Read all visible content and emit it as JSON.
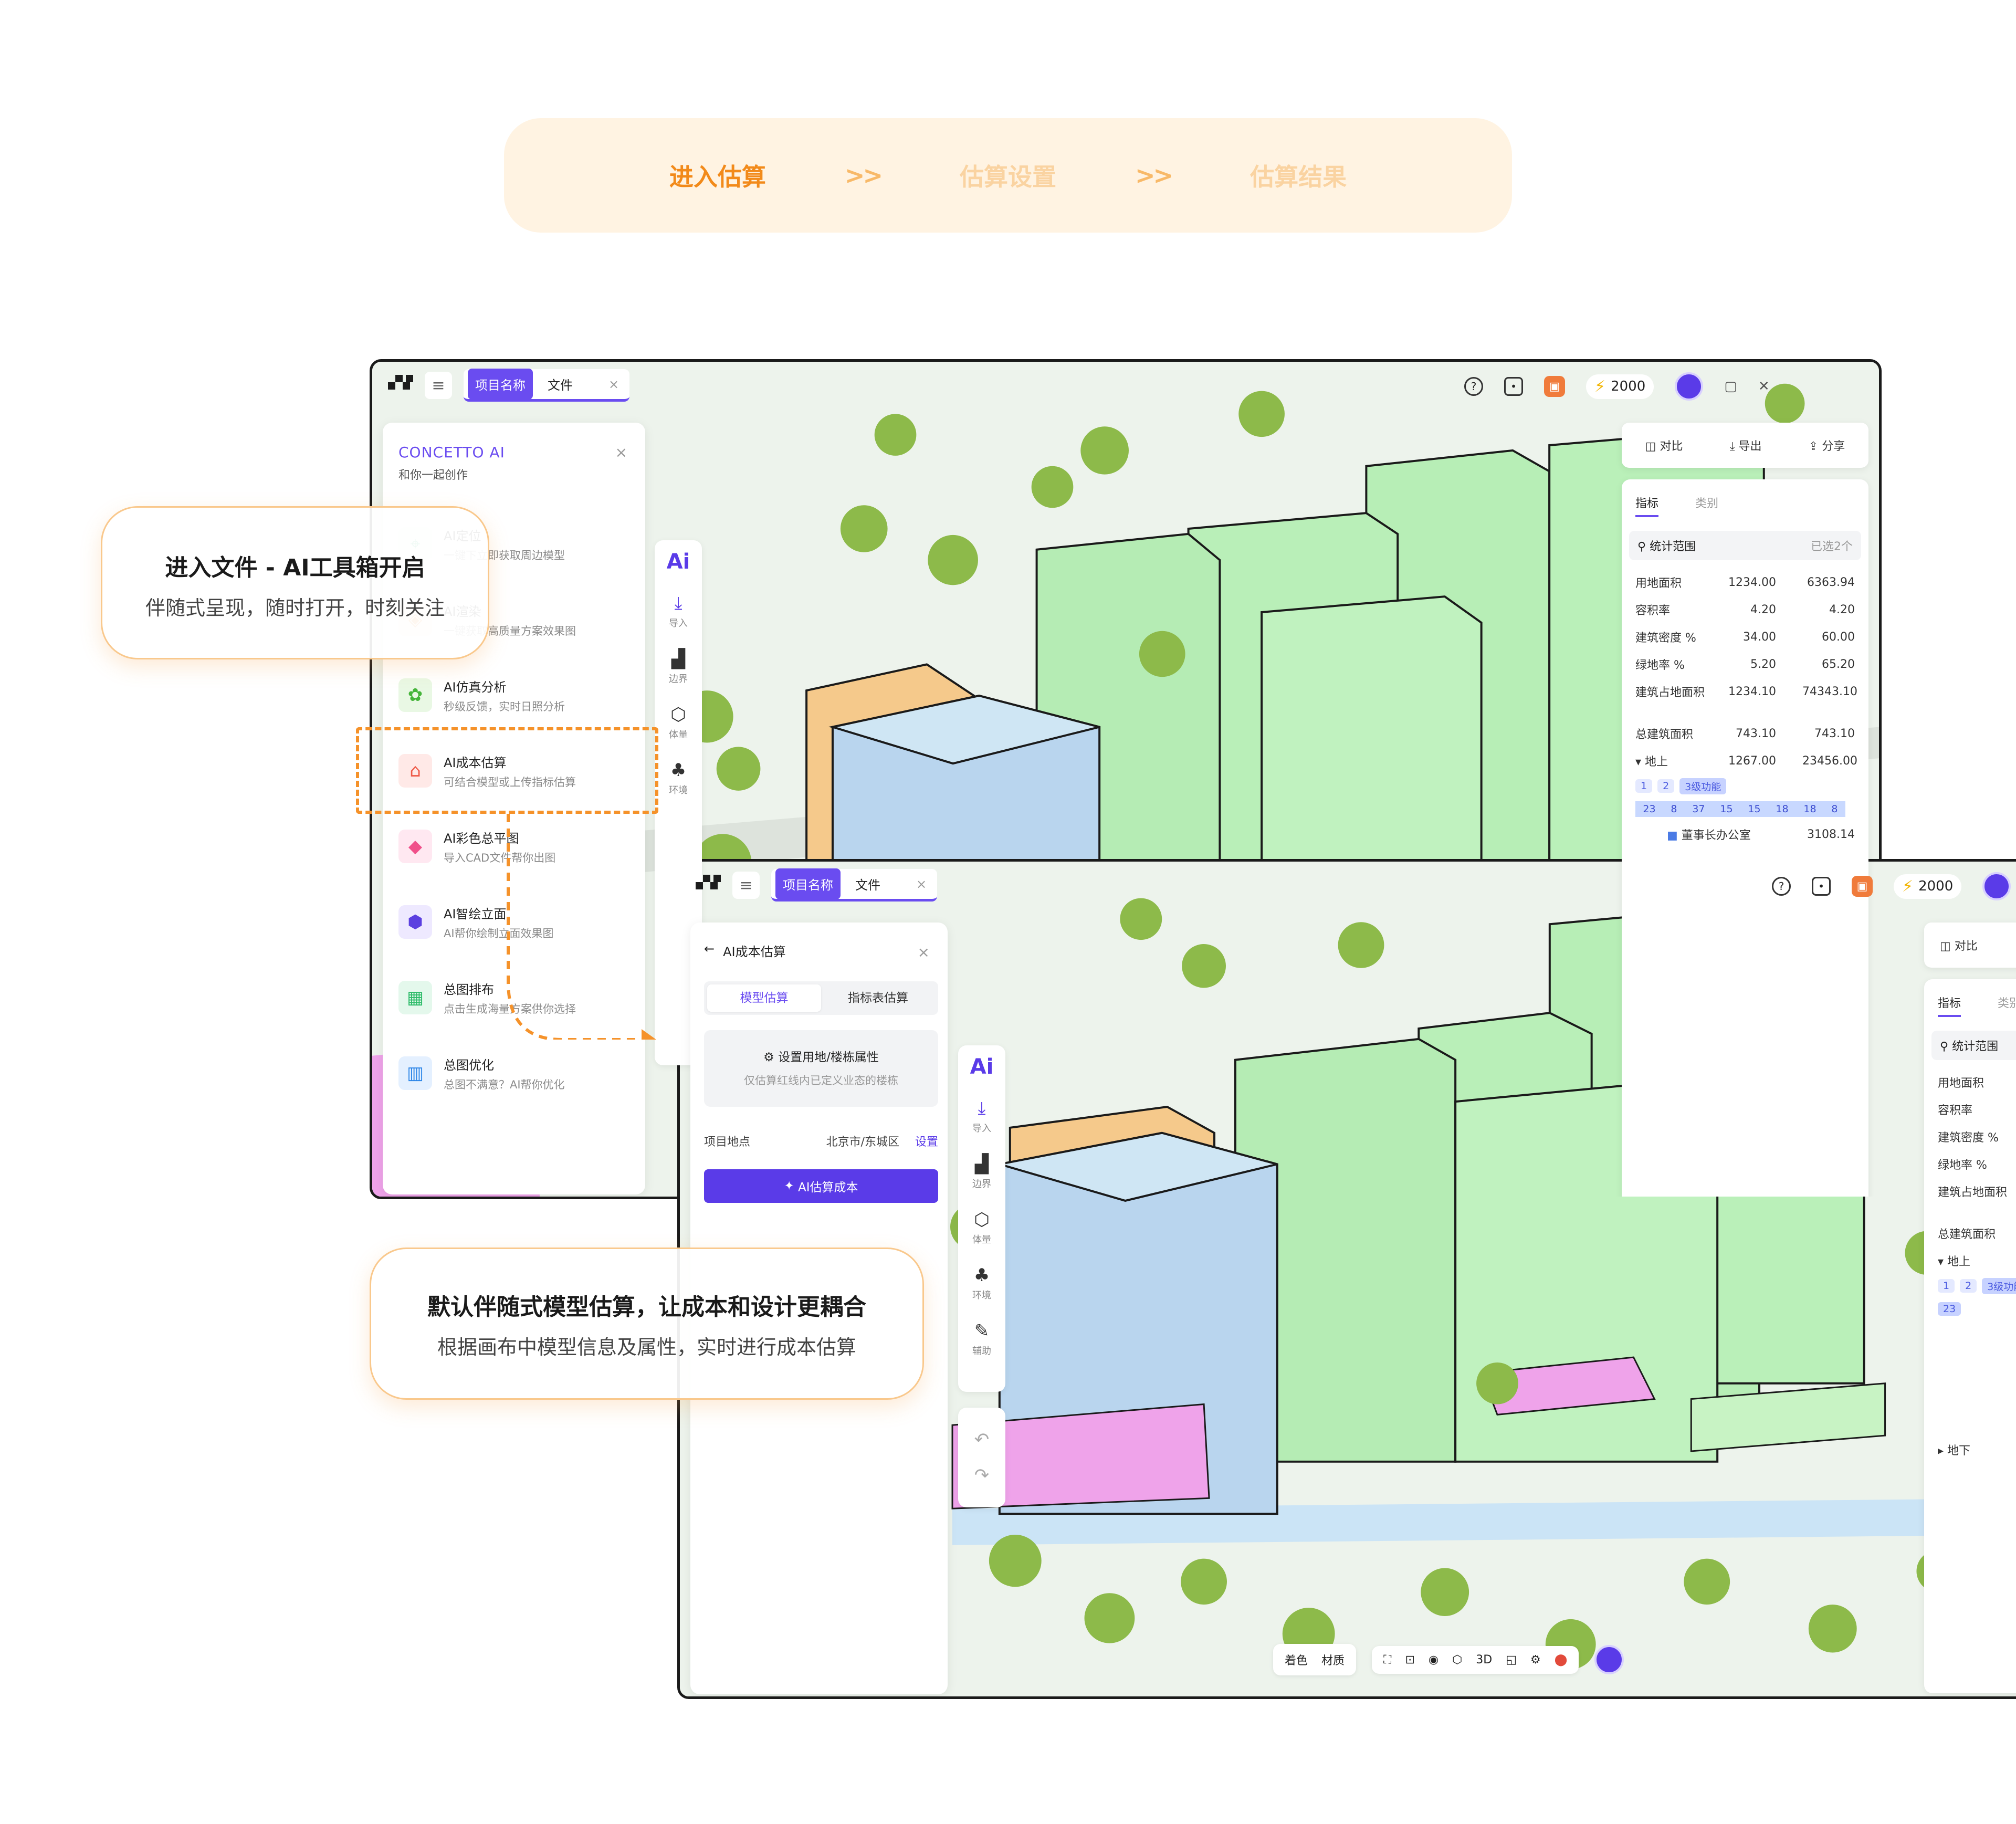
{
  "steps": {
    "step1": "进入估算",
    "sep1": ">>",
    "step2": "估算设置",
    "sep2": ">>",
    "step3": "估算结果",
    "active_color": "#F28A1A",
    "inactive_color": "#FAD3A1"
  },
  "callout1": {
    "title": "进入文件 - AI工具箱开启",
    "subtitle": "伴随式呈现，随时打开，时刻关注"
  },
  "callout2": {
    "title": "默认伴随式模型估算，让成本和设计更耦合",
    "subtitle": "根据画布中模型信息及属性，实时进行成本估算"
  },
  "topbar": {
    "project_tab": "项目名称",
    "file_tab": "文件",
    "close": "×",
    "credits": "2000"
  },
  "ai_panel": {
    "title": "CONCETTO AI",
    "subtitle": "和你一起创作",
    "close": "×",
    "tools": [
      {
        "name": "AI定位",
        "desc": "一键下立即获取周边模型",
        "icon": "map-pin-icon"
      },
      {
        "name": "AI渲染",
        "desc": "一键获取高质量方案效果图",
        "icon": "render-icon"
      },
      {
        "name": "AI仿真分析",
        "desc": "秒级反馈，实时日照分析",
        "icon": "simulation-icon"
      },
      {
        "name": "AI成本估算",
        "desc": "可结合模型或上传指标估算",
        "icon": "cost-icon"
      },
      {
        "name": "AI彩色总平图",
        "desc": "导入CAD文件帮你出图",
        "icon": "color-plan-icon"
      },
      {
        "name": "AI智绘立面",
        "desc": "AI帮你绘制立面效果图",
        "icon": "facade-icon"
      },
      {
        "name": "总图排布",
        "desc": "点击生成海量方案供你选择",
        "icon": "layout-grid-icon"
      },
      {
        "name": "总图优化",
        "desc": "总图不满意？AI帮你优化",
        "icon": "optimize-icon"
      }
    ]
  },
  "rail": {
    "import": "导入",
    "boundary": "边界",
    "volume": "体量",
    "env": "环境",
    "assist": "辅助"
  },
  "right_panel": {
    "compare": "对比",
    "export": "导出",
    "share": "分享",
    "tab_metrics": "指标",
    "tab_category": "类别",
    "scope_label": "统计范围",
    "scope_value": "已选2个",
    "rows": [
      {
        "label": "用地面积",
        "v1": "1234.00",
        "v2": "6363.94"
      },
      {
        "label": "容积率",
        "v1": "4.20",
        "v2": "4.20"
      },
      {
        "label": "建筑密度 %",
        "v1": "34.00",
        "v2": "60.00"
      },
      {
        "label": "绿地率 %",
        "v1": "5.20",
        "v2": "65.20"
      },
      {
        "label": "建筑占地面积",
        "v1": "1234.10",
        "v2": "74343.10"
      },
      {
        "label": "总建筑面积",
        "v1": "743.10",
        "v2": "743.10"
      }
    ],
    "above_ground": {
      "label": "地上",
      "v1": "1267.00",
      "v2": "23456.00"
    },
    "below_ground": "地下",
    "chips": [
      "1",
      "2",
      "3级功能"
    ],
    "levels": [
      "23",
      "8",
      "37",
      "15",
      "15",
      "18",
      "18",
      "8"
    ],
    "room": {
      "label": "董事长办公室",
      "value": "3108.14"
    }
  },
  "cost_panel": {
    "back": "←",
    "title": "AI成本估算",
    "close": "×",
    "tab_model": "模型估算",
    "tab_sheet": "指标表估算",
    "set_title": "设置用地/楼栋属性",
    "set_desc": "仅估算红线内已定义业态的楼栋",
    "loc_label": "项目地点",
    "loc_value": "北京市/东城区",
    "loc_link": "设置",
    "button": "AI估算成本"
  },
  "bottom_bar": {
    "color": "着色",
    "material": "材质",
    "mode3d": "3D"
  }
}
